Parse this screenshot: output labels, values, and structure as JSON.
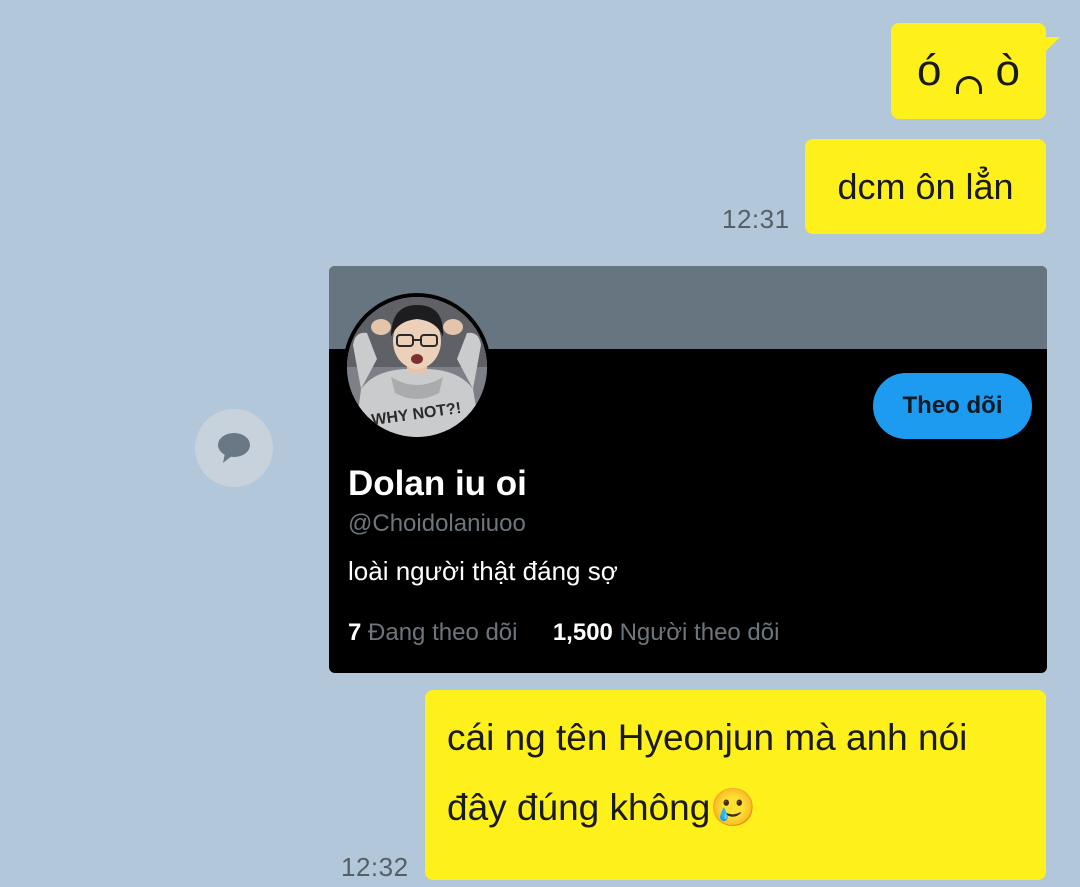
{
  "messages": {
    "first": {
      "left_eye": "ó",
      "right_eye": "ò"
    },
    "second": {
      "text": "dcm ôn lẳn",
      "time": "12:31"
    },
    "third": {
      "line1": "cái ng tên Hyeonjun mà anh nói",
      "line2": "đây đúng không",
      "emoji": "🥲",
      "time": "12:32"
    }
  },
  "profile_card": {
    "name": "Dolan iu oi",
    "handle": "@Choidolaniuoo",
    "bio": "loài người thật đáng sợ",
    "follow_button": "Theo dõi",
    "following_count": "7",
    "following_label": "Đang theo dõi",
    "followers_count": "1,500",
    "followers_label": "Người theo dõi",
    "avatar_shirt_text": "WHY NOT?!"
  },
  "icons": {
    "share": "speech-bubble-icon"
  },
  "colors": {
    "chat_background": "#b2c7d9",
    "my_bubble": "#fef01b",
    "card_background": "#000000",
    "card_banner": "#66757f",
    "follow_button": "#1d9bf0"
  }
}
